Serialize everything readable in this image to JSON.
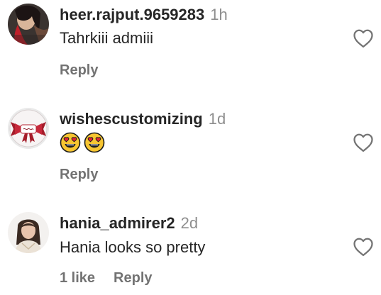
{
  "comments": [
    {
      "username": "heer.rajput.9659283",
      "time": "1h",
      "text": "Tahrkiii admiii",
      "reply_label": "Reply",
      "avatar_icon": "user-avatar-red-hair"
    },
    {
      "username": "wishescustomizing",
      "time": "1d",
      "emojis": [
        "heart-eyes-emoji",
        "heart-eyes-emoji"
      ],
      "reply_label": "Reply",
      "avatar_icon": "brand-logo-bow"
    },
    {
      "username": "hania_admirer2",
      "time": "2d",
      "text": "Hania looks so pretty",
      "likes_label": "1 like",
      "reply_label": "Reply",
      "avatar_icon": "user-avatar-woman"
    }
  ],
  "icons": {
    "like": "heart-outline-icon"
  },
  "colors": {
    "text": "#262626",
    "secondary": "#8e8e8e",
    "action": "#737373"
  }
}
